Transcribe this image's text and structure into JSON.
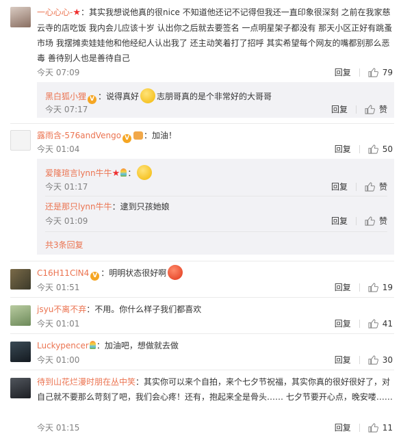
{
  "comments": [
    {
      "username": "一心心心-",
      "text": "：其实我想说他真的很nice 不知道他还记不记得但我还一直印象很深刻 之前在我家慈云寺的店吃饭 我内会儿应该十岁 认出你之后就去要签名 一点明星架子都没有 那天小区正好有跳蚤市场 我摆摊卖娃娃他和他经纪人认出我了 还主动笑着打了招呼 其实希望每个网友的嘴都别那么恶毒 善待别人也是善待自己",
      "time": "今天 07:09",
      "reply": "回复",
      "likes": "79",
      "replies": [
        {
          "username": "黑白狐小狸",
          "text_a": "：说得真好",
          "text_b": "志朋哥真的是个非常好的大哥哥",
          "time": "今天 07:17",
          "reply": "回复",
          "likes": "赞"
        }
      ]
    },
    {
      "username": "露雨含-576andVengo",
      "text": "：加油！",
      "time": "今天 01:04",
      "reply": "回复",
      "likes": "50",
      "replies": [
        {
          "username": "爱隆瑄言lynn牛牛",
          "text": "：",
          "time": "今天 01:17",
          "reply": "回复",
          "likes": "赞"
        },
        {
          "username": "还是那只lynn牛牛",
          "text": "：逮到只孩她娘",
          "time": "今天 01:09",
          "reply": "回复",
          "likes": "赞"
        }
      ],
      "more": "共3条回复"
    },
    {
      "username": "C16H11ClN4",
      "text": "：明明状态很好啊",
      "time": "今天 01:51",
      "reply": "回复",
      "likes": "19"
    },
    {
      "username": "jsyu不离不弃",
      "text": "：不用。你什么样子我们都喜欢",
      "time": "今天 01:01",
      "reply": "回复",
      "likes": "41"
    },
    {
      "username": "Luckypencer",
      "text": "：加油吧，想做就去做",
      "time": "今天 01:00",
      "reply": "回复",
      "likes": "30"
    },
    {
      "username": "待到山花烂漫时朋在丛中笑",
      "text": "：其实你可以来个自拍，来个七夕节祝福，其实你真的很好很好了，对自己就不要那么苛刻了吧，我们会心疼！还有，抱起来全是骨头……  七夕节要开心点，晚安喽……",
      "time": "今天 01:15",
      "reply": "回复",
      "likes": "11"
    }
  ]
}
